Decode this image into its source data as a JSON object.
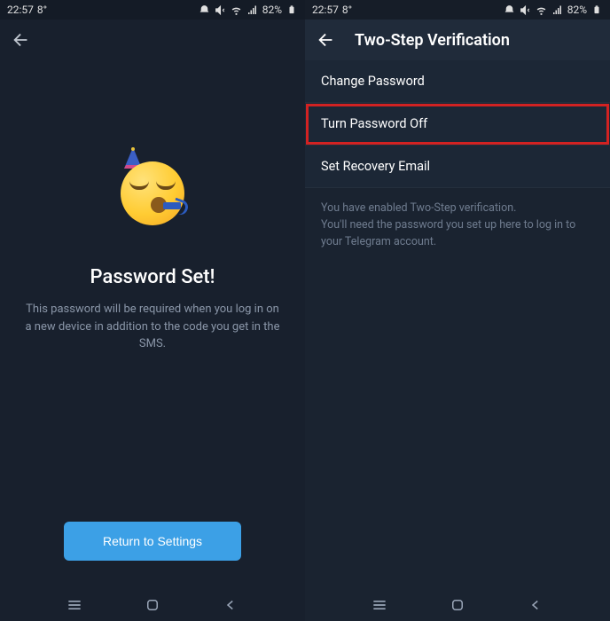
{
  "status": {
    "time": "22:57",
    "temp": "8°",
    "battery": "82%"
  },
  "left": {
    "title": "Password Set!",
    "description": "This password will be required when you log in on a new device in addition to the code you get in the SMS.",
    "button": "Return to Settings"
  },
  "right": {
    "header": "Two-Step Verification",
    "items": [
      "Change Password",
      "Turn Password Off",
      "Set Recovery Email"
    ],
    "info": "You have enabled Two-Step verification.\nYou'll need the password you set up here to log in to your Telegram account."
  }
}
